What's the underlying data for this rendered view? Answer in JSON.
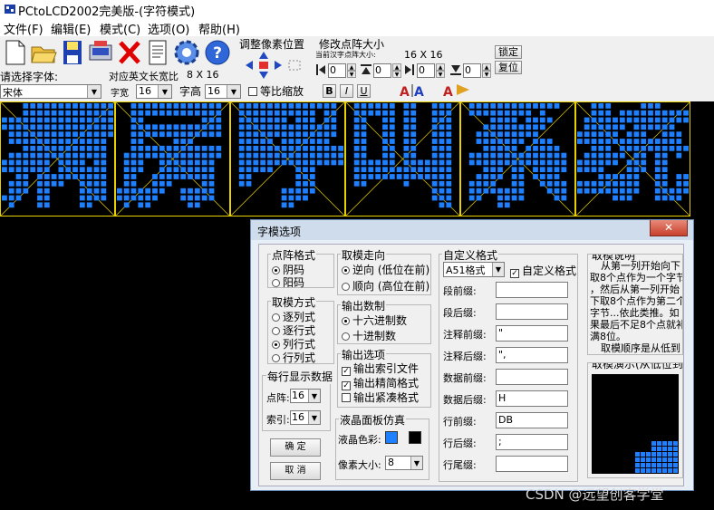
{
  "window": {
    "title": "PCtoLCD2002完美版-(字符模式)"
  },
  "menu": [
    "文件(F)",
    "编辑(E)",
    "模式(C)",
    "选项(O)",
    "帮助(H)"
  ],
  "toolbar": {
    "font_label": "请选择字体:",
    "font_value": "宋体",
    "ascii_size_label": "对应英文长宽比",
    "ascii_size_value": "8 X 16",
    "width_label": "字宽",
    "width_value": "16",
    "height_label": "字高",
    "height_value": "16",
    "proportional_label": "等比缩放",
    "adjust_label": "调整像素位置",
    "resize_label": "修改点阵大小",
    "current_size_label": "当前汉字点阵大小:",
    "current_size_value": "16 X 16",
    "set_button": "锁定",
    "restore_button": "复位",
    "bold": "B",
    "italic": "I",
    "underline": "U",
    "spin_values": [
      "0",
      "0",
      "0",
      "0"
    ]
  },
  "lcd": {
    "characters": [
      "病",
      "房",
      "呼",
      "叫",
      "系",
      "统"
    ],
    "dot_color": "#1e7fff",
    "grid_color": "#e8d000"
  },
  "dialog": {
    "title": "字模选项",
    "dot_format": {
      "label": "点阵格式",
      "options": [
        "阴码",
        "阳码"
      ],
      "selected": 0
    },
    "mode": {
      "label": "取模方式",
      "options": [
        "逐列式",
        "逐行式",
        "列行式",
        "行列式"
      ],
      "selected": 2
    },
    "per_line": {
      "label": "每行显示数据",
      "dot_label": "点阵:",
      "dot_value": "16",
      "index_label": "索引:",
      "index_value": "16"
    },
    "ok": "确 定",
    "cancel": "取 消",
    "direction": {
      "label": "取模走向",
      "options": [
        "逆向 (低位在前)",
        "顺向 (高位在前)"
      ],
      "selected": 0
    },
    "number": {
      "label": "输出数制",
      "options": [
        "十六进制数",
        "十进制数"
      ],
      "selected": 0
    },
    "output": {
      "label": "输出选项",
      "options": [
        "输出索引文件",
        "输出精简格式",
        "输出紧凑格式"
      ],
      "checked": [
        true,
        true,
        false
      ]
    },
    "lcd_sim": {
      "label": "液晶面板仿真",
      "color_label": "液晶色彩:",
      "pixel_label": "像素大小:",
      "pixel_value": "8"
    },
    "custom": {
      "label": "自定义格式",
      "format_value": "A51格式",
      "custom_check_label": "自定义格式",
      "custom_checked": true,
      "fields": [
        {
          "label": "段前缀:",
          "value": ""
        },
        {
          "label": "段后缀:",
          "value": ""
        },
        {
          "label": "注释前缀:",
          "value": "\""
        },
        {
          "label": "注释后缀:",
          "value": "\","
        },
        {
          "label": "数据前缀:",
          "value": ""
        },
        {
          "label": "数据后缀:",
          "value": "H"
        },
        {
          "label": "行前缀:",
          "value": "DB"
        },
        {
          "label": "行后缀:",
          "value": ";"
        },
        {
          "label": "行尾缀:",
          "value": ""
        }
      ]
    },
    "explain": {
      "label": "取模说明",
      "lines": [
        "从第一列开始向下",
        "取8个点作为一个字节",
        "，然后从第一列开始",
        "下取8个点作为第二个",
        "字节...依此类推。如",
        "果最后不足8个点就补",
        "满8位。",
        "取模顺序是从低到"
      ]
    },
    "demo": {
      "label": "取模演示(从低位到"
    }
  },
  "watermark": "CSDN @远望创客学堂"
}
